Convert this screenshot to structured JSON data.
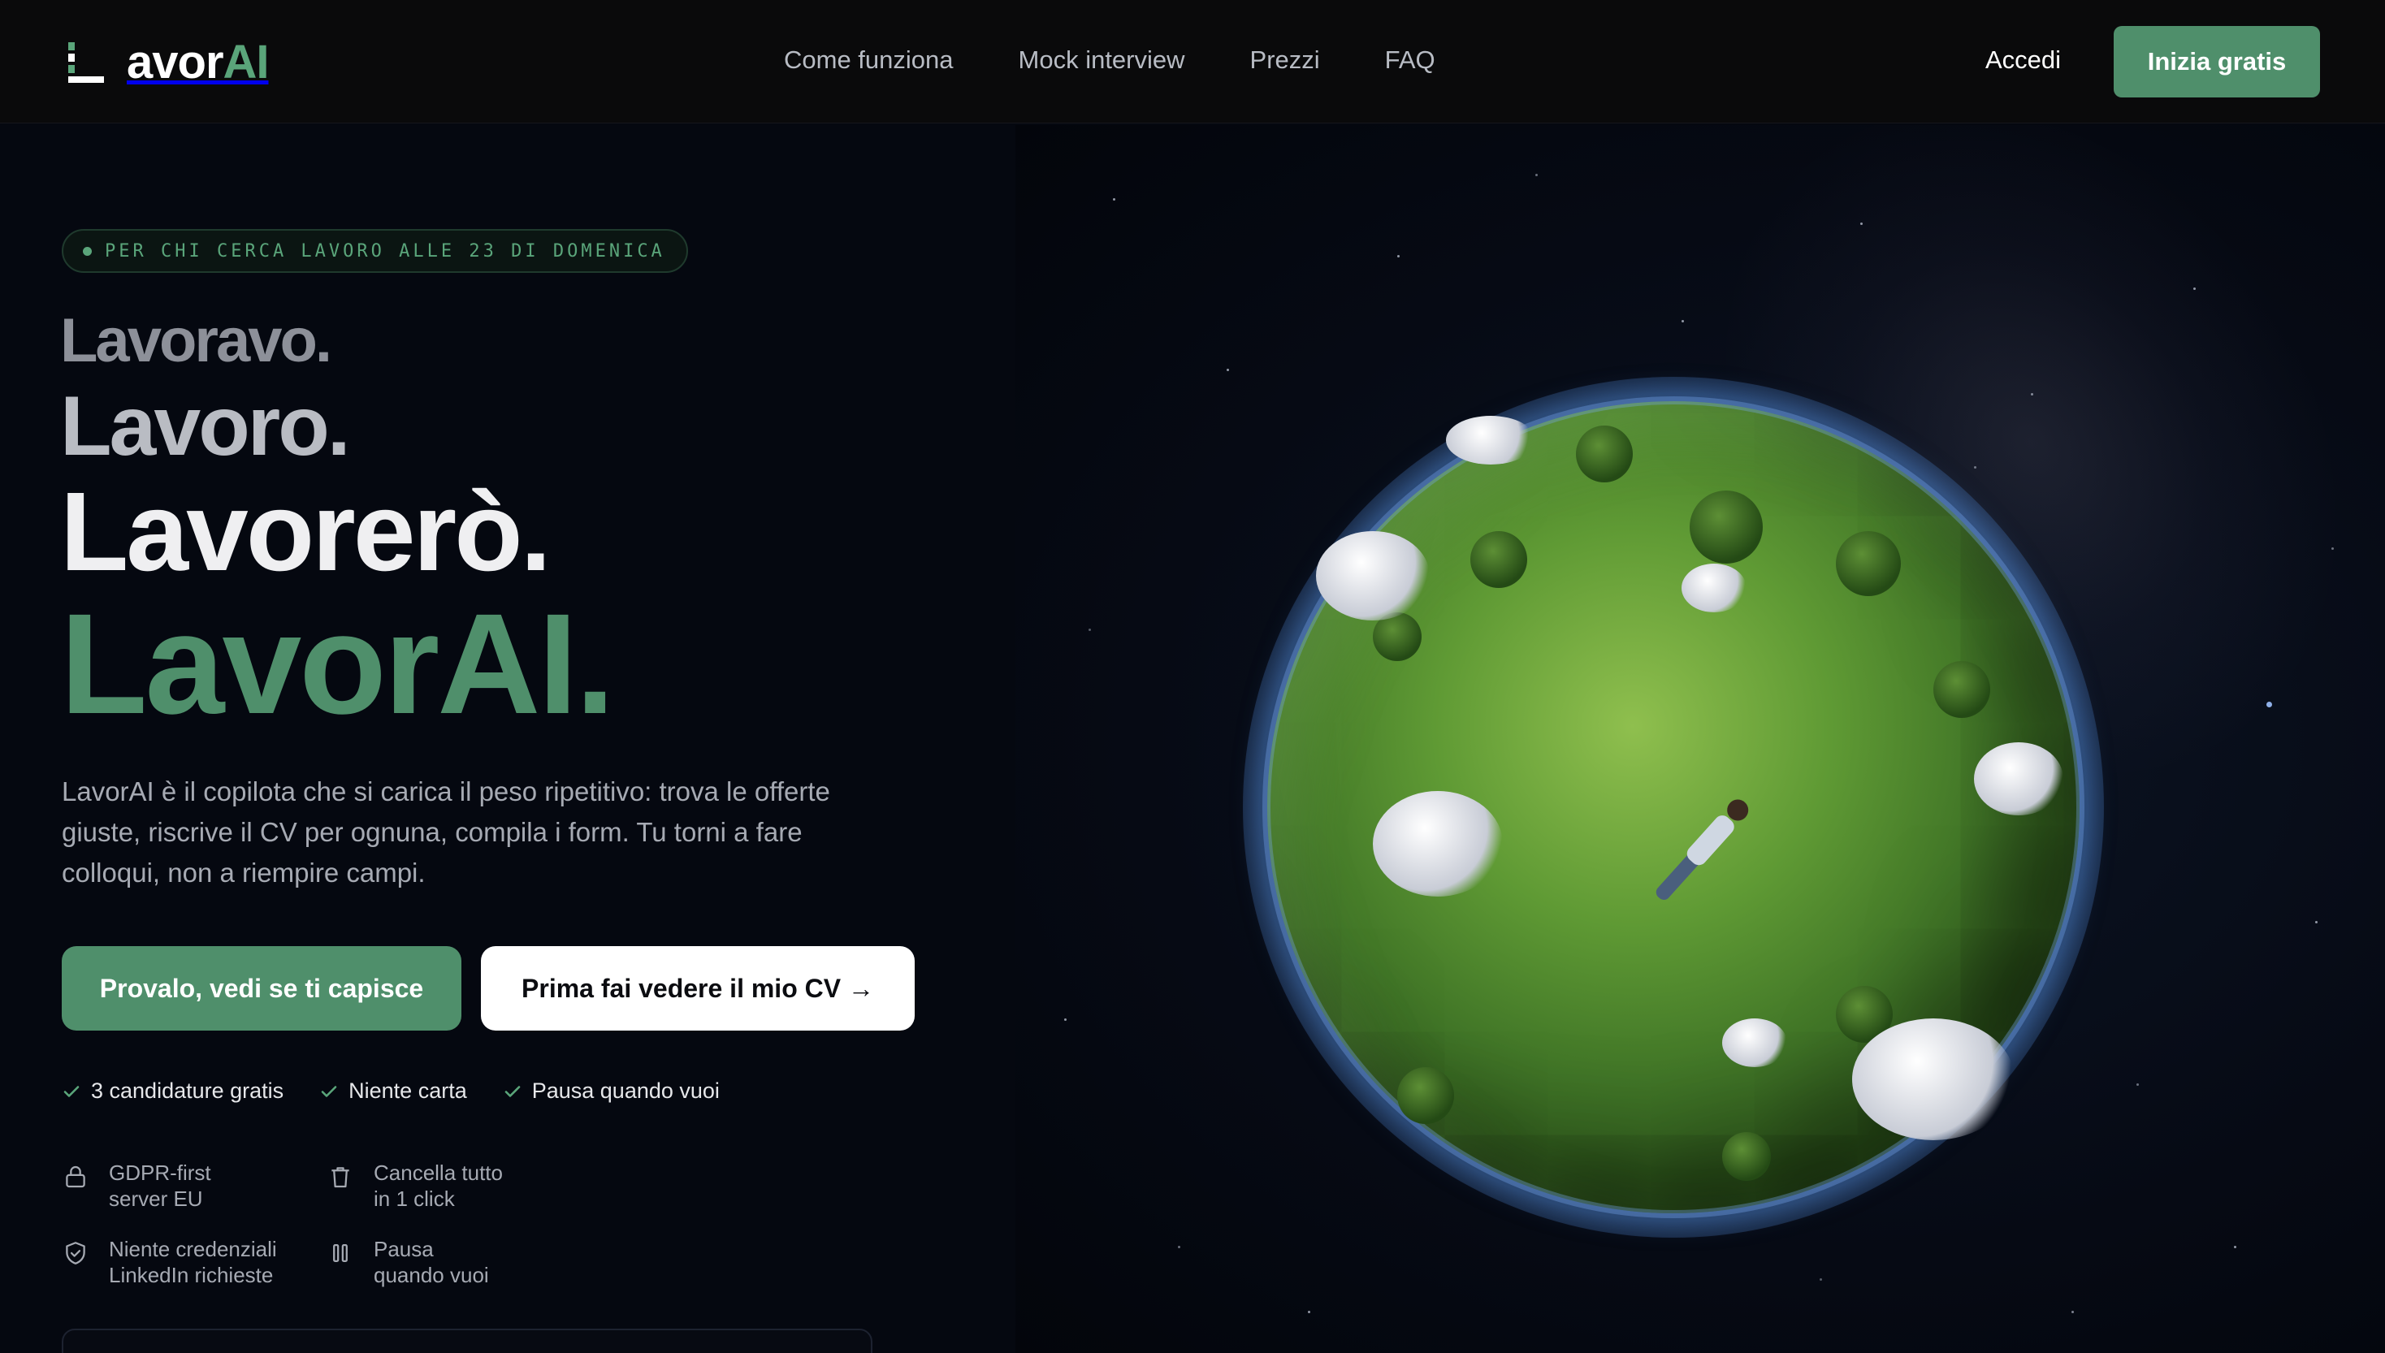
{
  "header": {
    "logo": {
      "text_main": "avor",
      "text_accent": "AI"
    },
    "nav": [
      {
        "label": "Come funziona"
      },
      {
        "label": "Mock interview"
      },
      {
        "label": "Prezzi"
      },
      {
        "label": "FAQ"
      }
    ],
    "login_label": "Accedi",
    "cta_label": "Inizia gratis"
  },
  "hero": {
    "badge": "PER CHI CERCA LAVORO ALLE 23 DI DOMENICA",
    "headline": [
      "Lavoravo.",
      "Lavoro.",
      "Lavorerò.",
      "LavorAI."
    ],
    "lead": "LavorAI è il copilota che si carica il peso ripetitivo: trova le offerte giuste, riscrive il CV per ognuna, compila i form. Tu torni a fare colloqui, non a riempire campi.",
    "primary_cta": "Provalo, vedi se ti capisce",
    "secondary_cta": "Prima fai vedere il mio CV →",
    "checks": [
      {
        "label": "3 candidature gratis"
      },
      {
        "label": "Niente carta"
      },
      {
        "label": "Pausa quando vuoi"
      }
    ],
    "trust": [
      {
        "icon": "lock-icon",
        "line1": "GDPR-first",
        "line2": "server EU"
      },
      {
        "icon": "trash-icon",
        "line1": "Cancella tutto",
        "line2": "in 1 click"
      },
      {
        "icon": "shield-check-icon",
        "line1": "Niente credenziali",
        "line2": "LinkedIn richieste"
      },
      {
        "icon": "pause-icon",
        "line1": "Pausa",
        "line2": "quando vuoi"
      }
    ]
  },
  "colors": {
    "accent": "#4f8f6b",
    "background": "#050810",
    "header_bg": "#0a0a0b"
  }
}
